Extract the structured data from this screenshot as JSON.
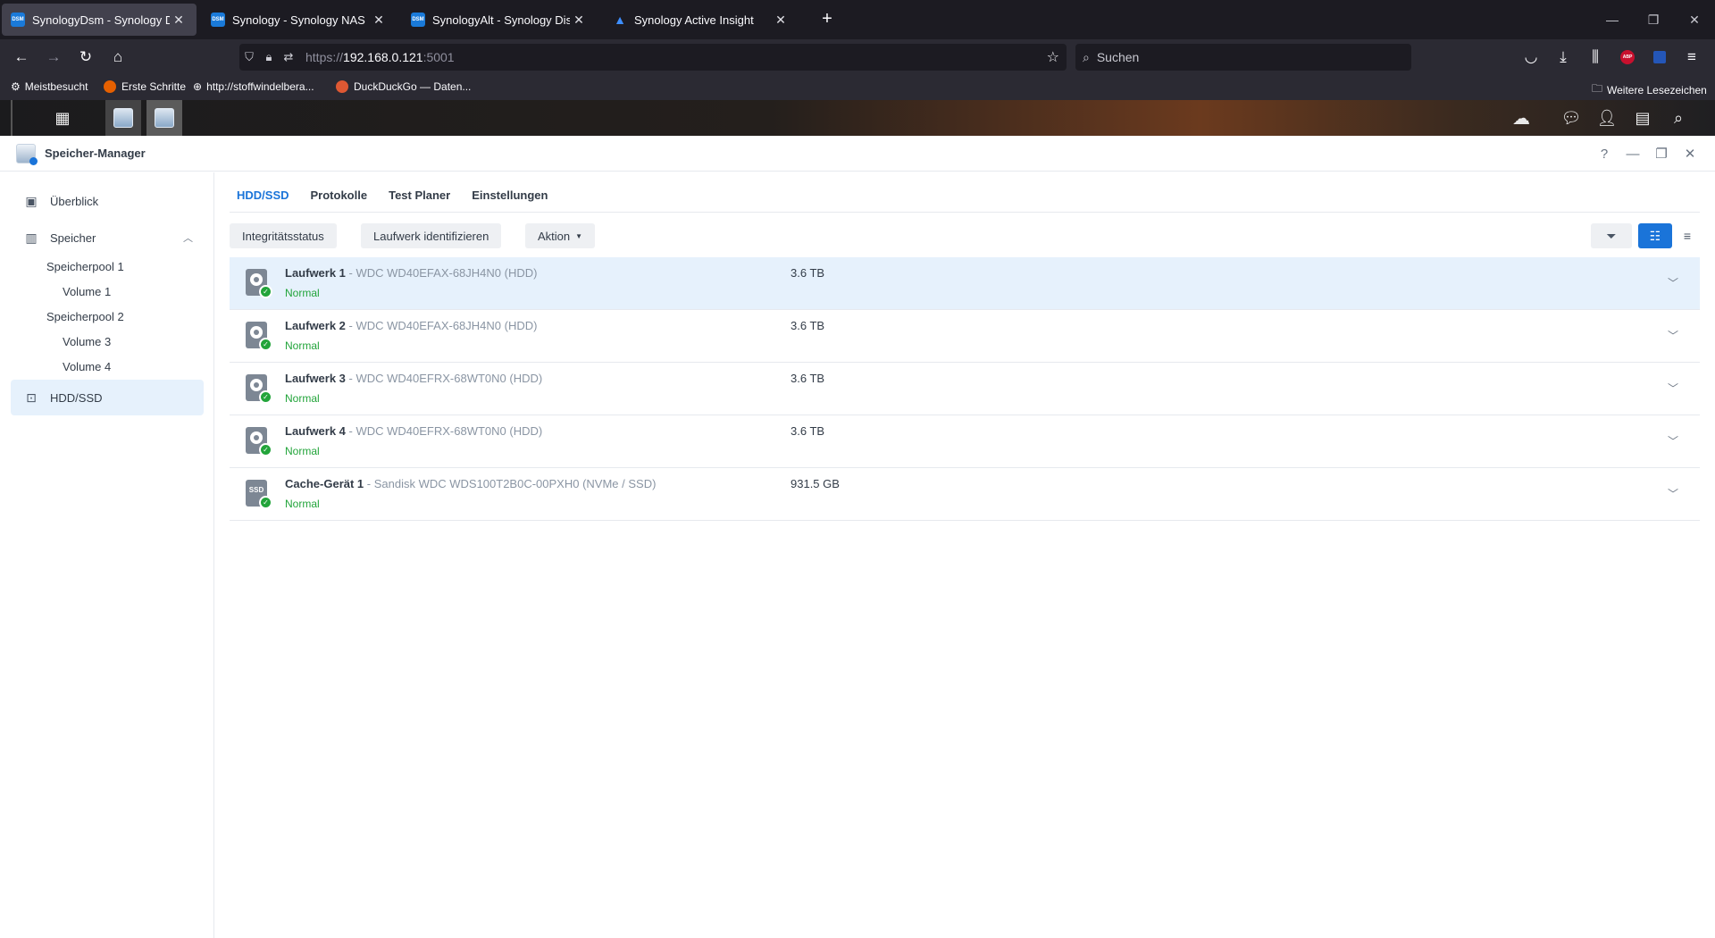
{
  "browser": {
    "tabs": [
      {
        "title": "SynologyDsm - Synology DiskStation",
        "favicon": "DSM"
      },
      {
        "title": "Synology - Synology NAS",
        "favicon": "DSM"
      },
      {
        "title": "SynologyAlt - Synology DiskStation",
        "favicon": "DSM"
      },
      {
        "title": "Synology Active Insight",
        "favicon": "triangle"
      }
    ],
    "url_prefix": "https://",
    "url_host": "192.168.0.121",
    "url_port": ":5001",
    "search_placeholder": "Suchen",
    "bookmarks": [
      "Meistbesucht",
      "Erste Schritte",
      "http://stoffwindelbera...",
      "DuckDuckGo — Daten..."
    ],
    "other_bookmarks": "Weitere Lesezeichen"
  },
  "window": {
    "title": "Speicher-Manager"
  },
  "sidebar": {
    "overview": "Überblick",
    "storage": "Speicher",
    "pool1": "Speicherpool 1",
    "volume1": "Volume 1",
    "pool2": "Speicherpool 2",
    "volume3": "Volume 3",
    "volume4": "Volume 4",
    "hdd_ssd": "HDD/SSD"
  },
  "tabs": [
    "HDD/SSD",
    "Protokolle",
    "Test Planer",
    "Einstellungen"
  ],
  "toolbar": {
    "health": "Integritätsstatus",
    "identify": "Laufwerk identifizieren",
    "action": "Aktion"
  },
  "drives": [
    {
      "name": "Laufwerk 1",
      "model": "WDC WD40EFAX-68JH4N0 (HDD)",
      "status": "Normal",
      "capacity": "3.6 TB",
      "type": "hdd"
    },
    {
      "name": "Laufwerk 2",
      "model": "WDC WD40EFAX-68JH4N0 (HDD)",
      "status": "Normal",
      "capacity": "3.6 TB",
      "type": "hdd"
    },
    {
      "name": "Laufwerk 3",
      "model": "WDC WD40EFRX-68WT0N0 (HDD)",
      "status": "Normal",
      "capacity": "3.6 TB",
      "type": "hdd"
    },
    {
      "name": "Laufwerk 4",
      "model": "WDC WD40EFRX-68WT0N0 (HDD)",
      "status": "Normal",
      "capacity": "3.6 TB",
      "type": "hdd"
    },
    {
      "name": "Cache-Gerät 1",
      "model": "Sandisk WDC WDS100T2B0C-00PXH0 (NVMe / SSD)",
      "status": "Normal",
      "capacity": "931.5 GB",
      "type": "ssd",
      "badge": "SSD"
    }
  ],
  "colors": {
    "accent": "#1a74d9",
    "status_ok": "#22a43a"
  }
}
